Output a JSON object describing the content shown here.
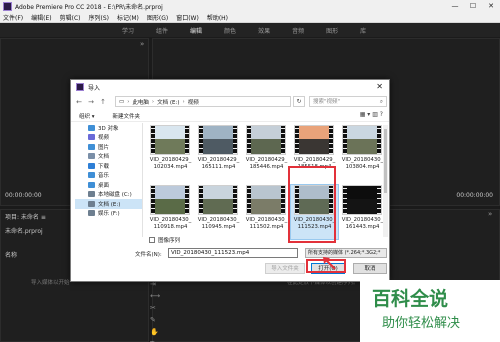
{
  "app": {
    "title": "Adobe Premiere Pro CC 2018 - E:\\PR\\未命名.prproj",
    "window_buttons": [
      "—",
      "☐",
      "✕"
    ]
  },
  "menu": [
    "文件(F)",
    "编辑(E)",
    "剪辑(C)",
    "序列(S)",
    "标记(M)",
    "图形(G)",
    "窗口(W)",
    "帮助(H)"
  ],
  "workspaces": [
    {
      "label": "学习",
      "active": false
    },
    {
      "label": "组件",
      "active": false
    },
    {
      "label": "编辑",
      "active": true
    },
    {
      "label": "颜色",
      "active": false
    },
    {
      "label": "效果",
      "active": false
    },
    {
      "label": "音频",
      "active": false
    },
    {
      "label": "图形",
      "active": false
    },
    {
      "label": "库",
      "active": false
    }
  ],
  "panels": {
    "left_top_timecode": "00:00:00:00",
    "project_tab": "项目: 未命名 ≡",
    "project_name": "未命名.prproj",
    "name_column": "名称",
    "import_hint": "导入媒体以开始",
    "timeline_hint": "在此处放下媒体以创建序列。",
    "timecode_right": "00:00:00:00"
  },
  "dialog": {
    "title": "导入",
    "close": "✕",
    "breadcrumb": [
      "此电脑",
      "文档 (E:)",
      "视频"
    ],
    "refresh": "↻",
    "search_placeholder": "搜索\"视频\"",
    "organize": "组织 ▾",
    "new_folder": "新建文件夹",
    "view_icons": "▦ ▾  ▥  ?",
    "nav_items": [
      {
        "label": "3D 对象",
        "color": "#3f8fd6",
        "selected": false
      },
      {
        "label": "视频",
        "color": "#6a6ad8",
        "selected": false
      },
      {
        "label": "图片",
        "color": "#3f8fd6",
        "selected": false
      },
      {
        "label": "文档",
        "color": "#7a8fa8",
        "selected": false
      },
      {
        "label": "下载",
        "color": "#2e7fd6",
        "selected": false
      },
      {
        "label": "音乐",
        "color": "#3f8fd6",
        "selected": false
      },
      {
        "label": "桌面",
        "color": "#3f8fd6",
        "selected": false
      },
      {
        "label": "本地磁盘 (C:)",
        "color": "#6e7f90",
        "selected": false
      },
      {
        "label": "文档 (E:)",
        "color": "#6e7f90",
        "selected": true
      },
      {
        "label": "娱乐 (F:)",
        "color": "#6e7f90",
        "selected": false
      }
    ],
    "files": [
      {
        "name": "VID_20180429_102034.mp4",
        "sky": "#d9e6ef",
        "ground": "#6f7a5a",
        "selected": false
      },
      {
        "name": "VID_20180429_165111.mp4",
        "sky": "#9fb3c4",
        "ground": "#4e5a63",
        "selected": false
      },
      {
        "name": "VID_20180429_185446.mp4",
        "sky": "#c5cfd8",
        "ground": "#5d6750",
        "selected": false
      },
      {
        "name": "VID_20180429_185518.mp4",
        "sky": "#e9a37a",
        "ground": "#3a3633",
        "selected": false
      },
      {
        "name": "VID_20180430_103804.mp4",
        "sky": "#cad7e1",
        "ground": "#6b7358",
        "selected": false
      },
      {
        "name": "VID_20180430_110918.mp4",
        "sky": "#bccadb",
        "ground": "#5a6b47",
        "selected": false
      },
      {
        "name": "VID_20180430_110945.mp4",
        "sky": "#c9d4dd",
        "ground": "#606b52",
        "selected": false
      },
      {
        "name": "VID_20180430_111502.mp4",
        "sky": "#b9c5cf",
        "ground": "#7b7c68",
        "selected": false
      },
      {
        "name": "VID_20180430_111523.mp4",
        "sky": "#aebdcb",
        "ground": "#5f6a55",
        "selected": true
      },
      {
        "name": "VID_20180430_161443.mp4",
        "sky": "#0d0d0d",
        "ground": "#141414",
        "selected": false
      }
    ],
    "image_sequence_label": "图像序列",
    "filename_label": "文件名(N):",
    "filename_value": "VID_20180430_111523.mp4",
    "filetype_value": "所有支持的媒体 (*.264;*.3G2;*",
    "import_folder_button": "导入文件夹",
    "open_button": "打开(O)",
    "cancel_button": "取消"
  },
  "watermark": {
    "logo": "百科全说",
    "tagline": "助你轻松解决",
    "color": "#2f8d4a"
  }
}
